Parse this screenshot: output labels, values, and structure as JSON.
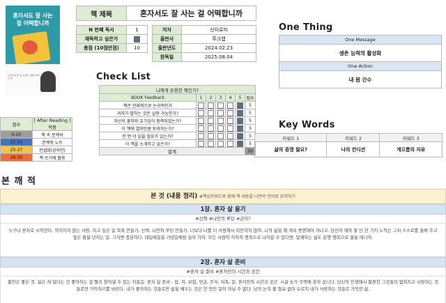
{
  "cover": {
    "title": "혼자서도 잘 사는 걸 어떡합니까",
    "blurb": "\"혼자서도 잘 살 수 있는 사람이 된다는 것\""
  },
  "book": {
    "title_label": "책 제목",
    "title": "혼자서도 잘 사는 걸 어떡합니까"
  },
  "info_left": [
    {
      "label": "N 번째 독서",
      "value": "1"
    },
    {
      "label": "재독하고 싶은가",
      "checked": true
    },
    {
      "label": "총점 (10점만점)",
      "value": "10"
    }
  ],
  "info_right": [
    {
      "label": "저자",
      "value": "신아로미"
    },
    {
      "label": "출판사",
      "value": "루크랩"
    },
    {
      "label": "출판년도",
      "value": "2024.02.23"
    },
    {
      "label": "완독일",
      "value": "2025.08.04"
    }
  ],
  "one_thing": {
    "heading": "One Thing",
    "message_label": "One Message",
    "message": "생존 능력의 활성화",
    "action_label": "One Action",
    "action": "내 몸 간수"
  },
  "checklist": {
    "heading": "Check List",
    "caption": "나에게 유용한 책인가?",
    "col_label": "BOOK Feedback",
    "cols": [
      "1",
      "2",
      "3",
      "4",
      "5"
    ],
    "score_label": "점수",
    "rows": [
      {
        "q": "책은 전체적으로 논리적인가",
        "checked": 5,
        "score": "5"
      },
      {
        "q": "저자가 말하는 것은 실현 가능한가?",
        "checked": 5,
        "score": "5"
      },
      {
        "q": "자신의 흥미와 호기심이 충족되었는가?",
        "checked": 5,
        "score": "5"
      },
      {
        "q": "이 책에 열마만큼 동의하는가?",
        "checked": 5,
        "score": "5"
      },
      {
        "q": "한 번 더 읽을 필요가 있는가?",
        "checked": 5,
        "score": "5"
      },
      {
        "q": "이 책을 소개하고 싶은가?",
        "checked": 5,
        "score": "5"
      }
    ],
    "total_label": "합계",
    "total": "30"
  },
  "legend": {
    "h_score": "점수",
    "h_after": "[ After Reading ] 적용",
    "rows": [
      {
        "range": "6-20",
        "label": "책 속 문젝석",
        "color": "#9e9e9e"
      },
      {
        "range": "21-24",
        "label": "본젝적 노트",
        "color": "#4472c4"
      },
      {
        "range": "25-27",
        "label": "컨셉화(강의안)",
        "color": "#f5c242"
      },
      {
        "range": "28-30",
        "label": "책 쓰기에 활용",
        "color": "#ee6b3b"
      }
    ]
  },
  "keywords": {
    "heading": "Key Words",
    "items": [
      {
        "label": "키워드 1",
        "value": "삶의 증명 필요?"
      },
      {
        "label": "키워드 2",
        "value": "나의 컨디션"
      },
      {
        "label": "키워드 3",
        "value": "게으름의 자유"
      }
    ]
  },
  "notes": {
    "heading": "본 깨 적",
    "summary_title": "본 것 (내용 정리)",
    "summary_sub": "#핵심키워드와 함께 책 내용을 나만의 언어로 요약하기",
    "chapters": [
      {
        "title": "1장. 혼자 살 용기",
        "tags": "#산책 #나만의 루틴 #굳이?",
        "body": "누구나 혼자로 시작한다. 의지하지 않는 사람. 하고 싶은 일 목록 만들기. 산책. 나만의 루틴 만들기. 너보다 나를 더 사랑해서 미안하지 않아. 나의 삶을 왜 계속 증명해야 하나고. 당신이 해야 할 단 한 가지 노력은 그저 스스로를 돌봐 주고 잎은 물을 던지는 일. 그거면 충분하다. 데일메일을 기념일체럼 살아 가자. 모든 사람이 각자의 행복으로 나아갈 수 있다면, 함께하는 삶도 분명 행복으로 물들 테니까."
      },
      {
        "title": "2장. 혼자 살 준비",
        "tags": "#혼자 살 준비 #혼자만의 시간과 공간",
        "body": "불안은 좋은 것. 싫은 게 많다는 건 좋아하는 걸 빨리 찾아낼 수 있는 지름길. 혼자 살 준비 - 집, 차, 보험, 연금, 주식, 저축, 일. 혼자만의 시간과 공간. 시골 농가 주택에 혼자 삽니다. 당신의 인생에서 불편한 그것들이 없어지고 사랑하는 것들로만 가득하기를 바란다. 내가 좋아하는 것들로만 삶을 채우는 것은 한 멋진 일이 아닐 수 없다. 남의 눈치 볼 필요 없이 오로지 내가 사랑하는 것들로 가득한 삶."
      }
    ]
  }
}
